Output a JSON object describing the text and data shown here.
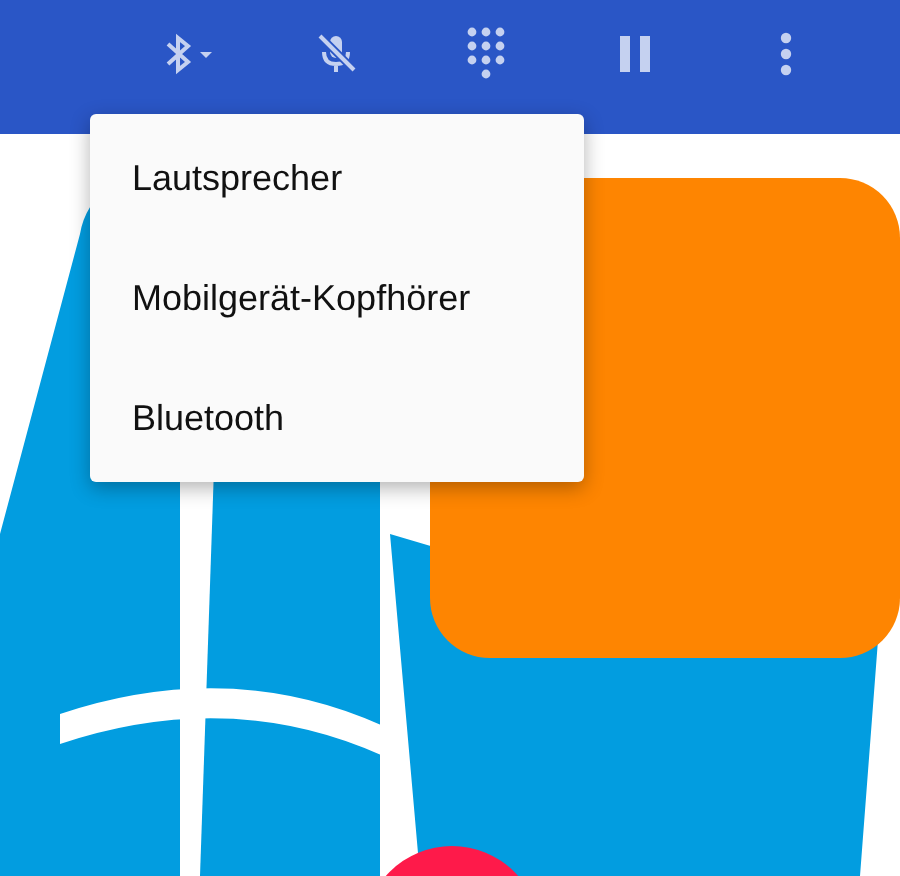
{
  "menu": {
    "items": [
      {
        "label": "Lautsprecher"
      },
      {
        "label": "Mobilgerät-Kopfhörer"
      },
      {
        "label": "Bluetooth"
      }
    ]
  }
}
